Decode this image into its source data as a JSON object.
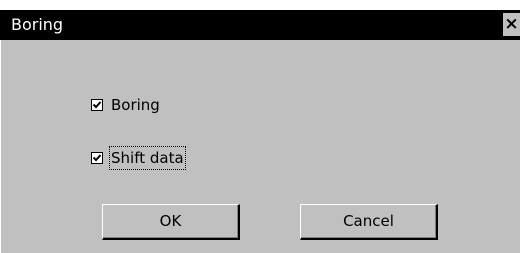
{
  "window": {
    "title": "Boring",
    "close_glyph": "×"
  },
  "options": [
    {
      "label": "Boring",
      "checked": true
    },
    {
      "label": "Shift data",
      "checked": true
    }
  ],
  "buttons": {
    "ok_label": "OK",
    "cancel_label": "Cancel"
  },
  "colors": {
    "titlebar": "#000000",
    "face": "#c0c0c0"
  }
}
